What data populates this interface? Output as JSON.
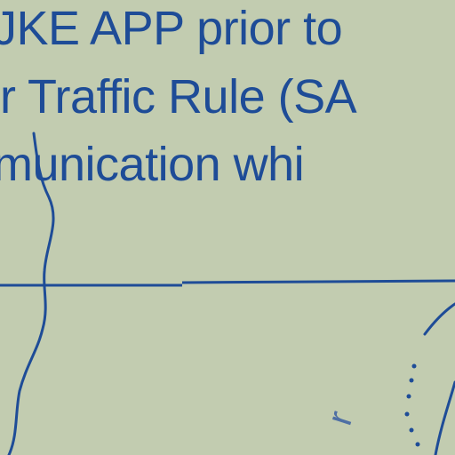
{
  "map_note": {
    "line1": "JKE APP prior to",
    "line2": "r Traffic Rule (SA",
    "line3": "munication whi"
  },
  "fragments": {
    "rotated_letter": "r"
  },
  "colors": {
    "background": "#c2ccb0",
    "text": "#1e4c97",
    "boundary": "#1e4c97",
    "river": "#1e4c97"
  }
}
